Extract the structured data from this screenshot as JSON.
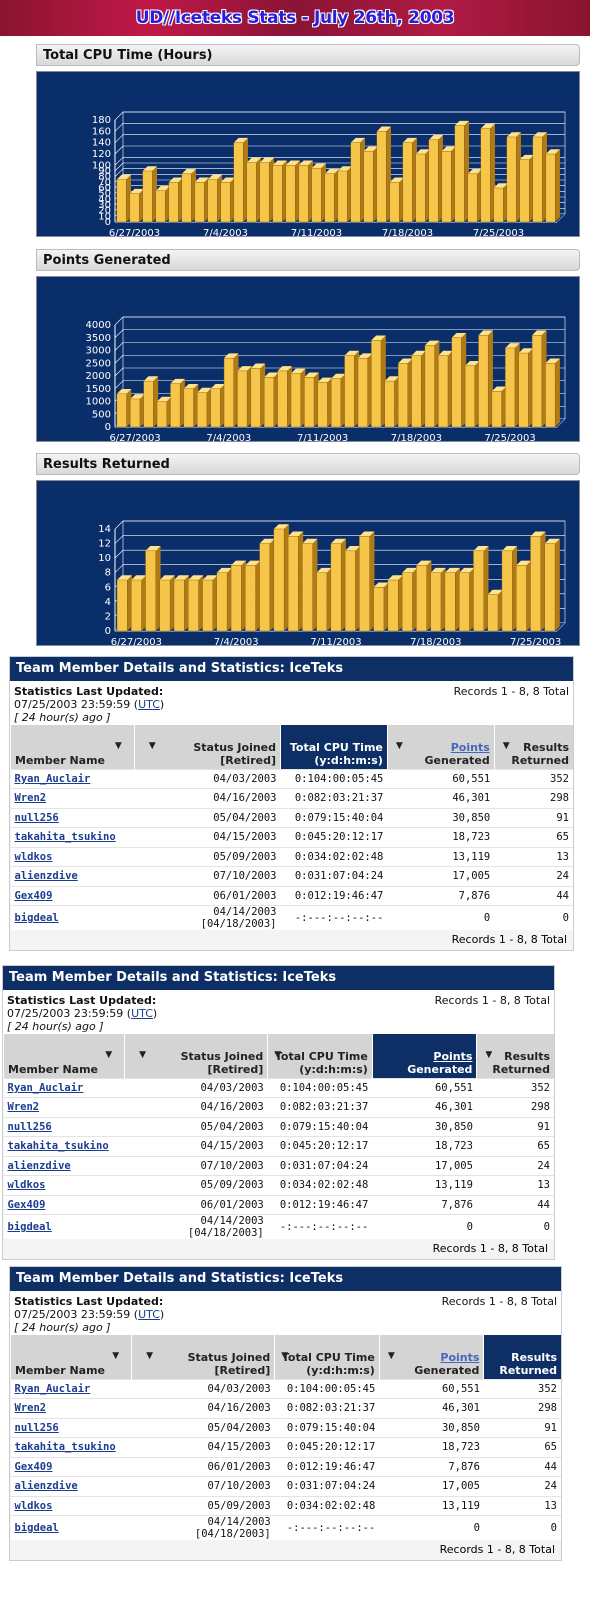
{
  "banner": {
    "title": "UD//Iceteks Stats - July 26th, 2003"
  },
  "charts": [
    {
      "title": "Total CPU Time (Hours)"
    },
    {
      "title": "Points Generated"
    },
    {
      "title": "Results Returned"
    }
  ],
  "chart_data": [
    {
      "type": "bar",
      "title": "Total CPU Time (Hours)",
      "xlabel": "",
      "ylabel": "",
      "ylim": [
        0,
        180
      ],
      "yticks": [
        0,
        10,
        20,
        30,
        40,
        50,
        60,
        70,
        80,
        90,
        100,
        120,
        140,
        160,
        180
      ],
      "ytick_labels": [
        "0",
        "10",
        "20",
        "30",
        "40",
        "50",
        "60",
        "70",
        "80",
        "90",
        "100",
        "120",
        "140",
        "160",
        "180"
      ],
      "x_tick_labels": [
        "6/27/2003",
        "7/4/2003",
        "7/11/2003",
        "7/18/2003",
        "7/25/2003"
      ],
      "x_tick_index": [
        1,
        8,
        15,
        22,
        29
      ],
      "values": [
        75,
        50,
        90,
        55,
        70,
        85,
        70,
        75,
        70,
        140,
        105,
        105,
        100,
        100,
        100,
        95,
        85,
        90,
        140,
        125,
        160,
        70,
        140,
        120,
        145,
        125,
        170,
        85,
        165,
        60,
        150,
        110,
        150,
        120
      ]
    },
    {
      "type": "bar",
      "title": "Points Generated",
      "xlabel": "",
      "ylabel": "",
      "ylim": [
        0,
        4000
      ],
      "ytick_labels": [
        "0",
        "500",
        "1000",
        "1500",
        "2000",
        "2500",
        "3000",
        "3500",
        "4000"
      ],
      "x_tick_labels": [
        "6/27/2003",
        "7/4/2003",
        "7/11/2003",
        "7/18/2003",
        "7/25/2003"
      ],
      "x_tick_index": [
        1,
        8,
        15,
        22,
        29
      ],
      "values": [
        1300,
        1100,
        1800,
        1000,
        1700,
        1500,
        1350,
        1500,
        2700,
        2200,
        2300,
        1950,
        2200,
        2100,
        1950,
        1750,
        1900,
        2800,
        2700,
        3400,
        1800,
        2500,
        2800,
        3200,
        2800,
        3500,
        2400,
        3600,
        1400,
        3100,
        2900,
        3600,
        2500
      ]
    },
    {
      "type": "bar",
      "title": "Results Returned",
      "xlabel": "",
      "ylabel": "",
      "ylim": [
        0,
        14
      ],
      "ytick_labels": [
        "0",
        "2",
        "4",
        "6",
        "8",
        "10",
        "12",
        "14"
      ],
      "x_tick_labels": [
        "6/27/2003",
        "7/4/2003",
        "7/11/2003",
        "7/18/2003",
        "7/25/2003"
      ],
      "x_tick_index": [
        1,
        8,
        15,
        22,
        29
      ],
      "values": [
        7,
        7,
        11,
        7,
        7,
        7,
        7,
        8,
        9,
        9,
        12,
        14,
        13,
        12,
        8,
        12,
        11,
        13,
        6,
        7,
        8,
        9,
        8,
        8,
        8,
        11,
        5,
        11,
        9,
        13,
        12
      ]
    }
  ],
  "tables": [
    {
      "title": "Team Member Details and Statistics: IceTeks",
      "updated_label": "Statistics Last Updated:",
      "updated_value": "07/25/2003 23:59:59",
      "utc": "UTC",
      "ago": "[ 24 hour(s) ago ]",
      "records": "Records 1 - 8, 8 Total",
      "headers": {
        "member": "Member Name",
        "status": "Status Joined [Retired]",
        "cpu": "Total CPU Time (y:d:h:m:s)",
        "points_link": "Points",
        "points": "Generated",
        "results": "Results Returned"
      },
      "active": "cpu",
      "rows": [
        [
          "Ryan_Auclair",
          "04/03/2003",
          "0:104:00:05:45",
          "60,551",
          "352"
        ],
        [
          "Wren2",
          "04/16/2003",
          "0:082:03:21:37",
          "46,301",
          "298"
        ],
        [
          "null256",
          "05/04/2003",
          "0:079:15:40:04",
          "30,850",
          "91"
        ],
        [
          "takahita_tsukino",
          "04/15/2003",
          "0:045:20:12:17",
          "18,723",
          "65"
        ],
        [
          "wldkos",
          "05/09/2003",
          "0:034:02:02:48",
          "13,119",
          "13"
        ],
        [
          "alienzdive",
          "07/10/2003",
          "0:031:07:04:24",
          "17,005",
          "24"
        ],
        [
          "Gex409",
          "06/01/2003",
          "0:012:19:46:47",
          "7,876",
          "44"
        ],
        [
          "bigdeal",
          "04/14/2003 [04/18/2003]",
          "-:---:--:--:--",
          "0",
          "0"
        ]
      ]
    },
    {
      "title": "Team Member Details and Statistics: IceTeks",
      "updated_label": "Statistics Last Updated:",
      "updated_value": "07/25/2003 23:59:59",
      "utc": "UTC",
      "ago": "[ 24 hour(s) ago ]",
      "records": "Records 1 - 8, 8 Total",
      "headers": {
        "member": "Member Name",
        "status": "Status Joined [Retired]",
        "cpu": "Total CPU Time (y:d:h:m:s)",
        "points_link": "Points",
        "points": "Generated",
        "results": "Results Returned"
      },
      "active": "points",
      "rows": [
        [
          "Ryan_Auclair",
          "04/03/2003",
          "0:104:00:05:45",
          "60,551",
          "352"
        ],
        [
          "Wren2",
          "04/16/2003",
          "0:082:03:21:37",
          "46,301",
          "298"
        ],
        [
          "null256",
          "05/04/2003",
          "0:079:15:40:04",
          "30,850",
          "91"
        ],
        [
          "takahita_tsukino",
          "04/15/2003",
          "0:045:20:12:17",
          "18,723",
          "65"
        ],
        [
          "alienzdive",
          "07/10/2003",
          "0:031:07:04:24",
          "17,005",
          "24"
        ],
        [
          "wldkos",
          "05/09/2003",
          "0:034:02:02:48",
          "13,119",
          "13"
        ],
        [
          "Gex409",
          "06/01/2003",
          "0:012:19:46:47",
          "7,876",
          "44"
        ],
        [
          "bigdeal",
          "04/14/2003 [04/18/2003]",
          "-:---:--:--:--",
          "0",
          "0"
        ]
      ]
    },
    {
      "title": "Team Member Details and Statistics: IceTeks",
      "updated_label": "Statistics Last Updated:",
      "updated_value": "07/25/2003 23:59:59",
      "utc": "UTC",
      "ago": "[ 24 hour(s) ago ]",
      "records": "Records 1 - 8, 8 Total",
      "headers": {
        "member": "Member Name",
        "status": "Status Joined [Retired]",
        "cpu": "Total CPU Time (y:d:h:m:s)",
        "points_link": "Points",
        "points": "Generated",
        "results": "Results Returned"
      },
      "active": "results",
      "rows": [
        [
          "Ryan_Auclair",
          "04/03/2003",
          "0:104:00:05:45",
          "60,551",
          "352"
        ],
        [
          "Wren2",
          "04/16/2003",
          "0:082:03:21:37",
          "46,301",
          "298"
        ],
        [
          "null256",
          "05/04/2003",
          "0:079:15:40:04",
          "30,850",
          "91"
        ],
        [
          "takahita_tsukino",
          "04/15/2003",
          "0:045:20:12:17",
          "18,723",
          "65"
        ],
        [
          "Gex409",
          "06/01/2003",
          "0:012:19:46:47",
          "7,876",
          "44"
        ],
        [
          "alienzdive",
          "07/10/2003",
          "0:031:07:04:24",
          "17,005",
          "24"
        ],
        [
          "wldkos",
          "05/09/2003",
          "0:034:02:02:48",
          "13,119",
          "13"
        ],
        [
          "bigdeal",
          "04/14/2003 [04/18/2003]",
          "-:---:--:--:--",
          "0",
          "0"
        ]
      ]
    }
  ],
  "colors": {
    "chart_bg": "#0a2e6a",
    "bar_front": "#f5c64a",
    "bar_side": "#b07a14",
    "bar_top": "#ffe28a",
    "header_blue": "#0e2f66"
  }
}
